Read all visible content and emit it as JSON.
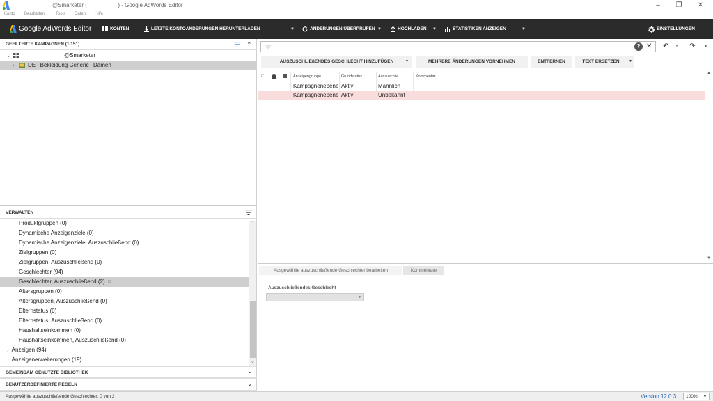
{
  "window": {
    "title_prefix": "@Smarketer (",
    "title_suffix": ") - Google AdWords Editor",
    "minimize": "–",
    "maximize": "❐",
    "close": "✕"
  },
  "menu": [
    "Konto",
    "Bearbeiten",
    "Tools",
    "Daten",
    "Hilfe"
  ],
  "toolbar": {
    "brand": "Google AdWords Editor",
    "accounts": "KONTEN",
    "download": "LETZTE KONTOÄNDERUNGEN HERUNTERLADEN",
    "check": "ÄNDERUNGEN ÜBERPRÜFEN",
    "upload": "HOCHLADEN",
    "stats": "STATISTIKEN ANZEIGEN",
    "settings": "EINSTELLUNGEN"
  },
  "campaigns": {
    "heading": "GEFILTERTE KAMPAGNEN (1/151)",
    "account": "@Smarketer",
    "campaign": "DE | Bekleidung Generic | Damen"
  },
  "manage": {
    "heading": "VERWALTEN",
    "items": [
      "Produktgruppen (0)",
      "Dynamische Anzeigenziele (0)",
      "Dynamische Anzeigenziele, Auszuschließend (0)",
      "Zielgruppen (0)",
      "Zielgruppen, Auszuschließend (0)",
      "Geschlechter (94)",
      "Geschlechter, Auszuschließend (2)",
      "Altersgruppen (0)",
      "Altersgruppen, Auszuschließend (0)",
      "Elternstatus (0)",
      "Elternstatus, Auszuschließend (0)",
      "Haushaltseinkommen (0)",
      "Haushaltseinkommen, Auszuschließend (0)"
    ],
    "groups": [
      "Anzeigen (94)",
      "Anzeigenerweiterungen (19)"
    ]
  },
  "library": "GEMEINSAM GENUTZTE BIBLIOTHEK",
  "custom_rules": "BENUTZERDEFINIERTE REGELN",
  "actions": {
    "add": "AUSZUSCHLIEßENDES GESCHLECHT HINZUFÜGEN",
    "multi": "MEHRERE ÄNDERUNGEN VORNEHMEN",
    "remove": "ENTFERNEN",
    "replace": "TEXT ERSETZEN"
  },
  "grid": {
    "columns": [
      "Anzeigengruppe",
      "Grundstatus",
      "Auszuschlie...",
      "Kommentar"
    ],
    "rows": [
      {
        "group": "Kampagnenebene",
        "status": "Aktiv",
        "gender": "Männlich"
      },
      {
        "group": "Kampagnenebene",
        "status": "Aktiv",
        "gender": "Unbekannt"
      }
    ]
  },
  "edit": {
    "tabs": [
      "Ausgewählte auszuschließende Geschlechter bearbeiten",
      "Kommentare"
    ],
    "field_label": "Auszuschließendes Geschlecht",
    "field_value": ""
  },
  "status": {
    "selection": "Ausgewählte auszuschließende Geschlechter: 0 von 2",
    "version": "Version 12.0.3",
    "zoom": "100%"
  },
  "colors": {
    "toolbar_bg": "#2b2b2b",
    "selected_row": "#f9dcdc",
    "selected_tree": "#cfcfcf",
    "brand_blue": "#4285f4",
    "version_blue": "#1a5fb4"
  }
}
